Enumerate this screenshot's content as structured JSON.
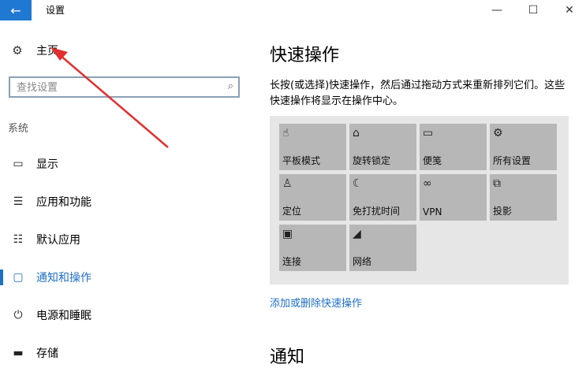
{
  "window": {
    "title": "设置",
    "back_icon": "←",
    "min_icon": "—",
    "max_icon": "☐",
    "close_icon": "✕"
  },
  "sidebar": {
    "home_label": "主页",
    "home_icon": "⚙",
    "search_placeholder": "查找设置",
    "search_icon": "⌕",
    "group_label": "系统",
    "items": [
      {
        "label": "显示",
        "icon": "▭"
      },
      {
        "label": "应用和功能",
        "icon": "☰"
      },
      {
        "label": "默认应用",
        "icon": "☷"
      },
      {
        "label": "通知和操作",
        "icon": "▢"
      },
      {
        "label": "电源和睡眠",
        "icon": "⏻"
      },
      {
        "label": "存储",
        "icon": "▬"
      }
    ],
    "active_index": 3
  },
  "main": {
    "title": "快速操作",
    "description": "长按(或选择)快速操作，然后通过拖动方式来重新排列它们。这些快速操作将显示在操作中心。",
    "tiles": [
      {
        "label": "平板模式",
        "icon": "☝"
      },
      {
        "label": "旋转锁定",
        "icon": "⌂"
      },
      {
        "label": "便笺",
        "icon": "▭"
      },
      {
        "label": "所有设置",
        "icon": "⚙"
      },
      {
        "label": "定位",
        "icon": "♙"
      },
      {
        "label": "免打扰时间",
        "icon": "☾"
      },
      {
        "label": "VPN",
        "icon": "∞"
      },
      {
        "label": "投影",
        "icon": "⧉"
      },
      {
        "label": "连接",
        "icon": "▣"
      },
      {
        "label": "网络",
        "icon": "◢"
      }
    ],
    "add_remove_link": "添加或删除快速操作",
    "notify_section_title": "通知"
  },
  "colors": {
    "accent": "#1f6fc5",
    "annotation_arrow": "#e0302f",
    "tile_bg": "#b7b7b7",
    "panel_bg": "#e6e6e6"
  }
}
